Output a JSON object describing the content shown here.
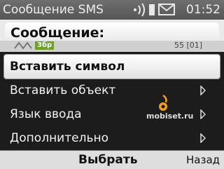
{
  "status_bar": {
    "title": "Сообщение SMS",
    "time": "01:52",
    "icons": [
      "signal-indicator-icon",
      "envelope-icon"
    ]
  },
  "message": {
    "heading": "Сообщение:",
    "badge": "3бр",
    "counter": "55 [01]"
  },
  "menu": {
    "items": [
      {
        "label": "Вставить символ",
        "selected": true,
        "has_submenu": false
      },
      {
        "label": "Вставить объект",
        "selected": false,
        "has_submenu": true
      },
      {
        "label": "Язык ввода",
        "selected": false,
        "has_submenu": true
      },
      {
        "label": "Дополнительно",
        "selected": false,
        "has_submenu": true
      }
    ]
  },
  "watermark": {
    "text": "mobiset.ru"
  },
  "softkeys": {
    "select": "Выбрать",
    "back": "Назад"
  },
  "colors": {
    "menu_background": "#1c1c1c",
    "highlight": "#ffffff",
    "status_bar": "#5f5f5f",
    "watermark_orange": "#f0a020"
  }
}
